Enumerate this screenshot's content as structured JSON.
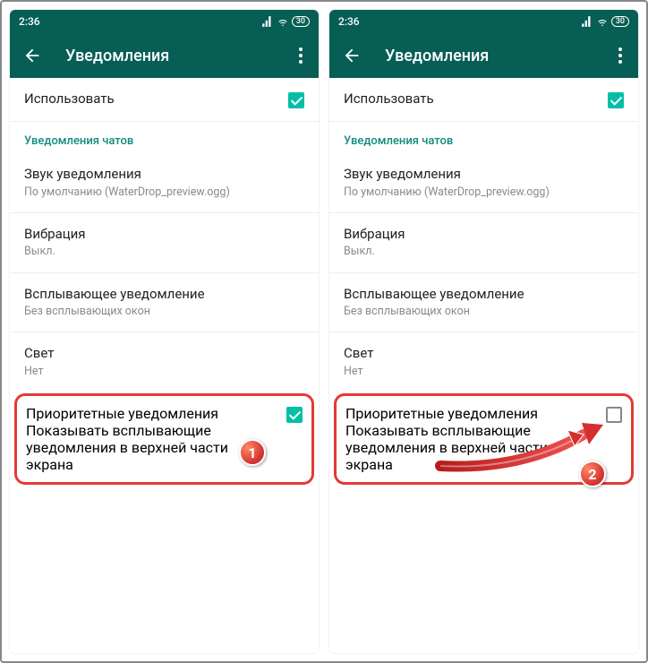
{
  "status": {
    "time": "2:36"
  },
  "appbar": {
    "title": "Уведомления"
  },
  "rows": {
    "use": "Использовать",
    "section": "Уведомления чатов",
    "sound_label": "Звук уведомления",
    "sound_sub": "По умолчанию (WaterDrop_preview.ogg)",
    "vibration_label": "Вибрация",
    "vibration_sub": "Выкл.",
    "popup_label": "Всплывающее уведомление",
    "popup_sub": "Без всплывающих окон",
    "light_label": "Свет",
    "light_sub": "Нет",
    "priority_label": "Приоритетные уведомления",
    "priority_sub": "Показывать всплывающие уведомления в верхней части экрана"
  },
  "badges": {
    "one": "1",
    "two": "2"
  }
}
